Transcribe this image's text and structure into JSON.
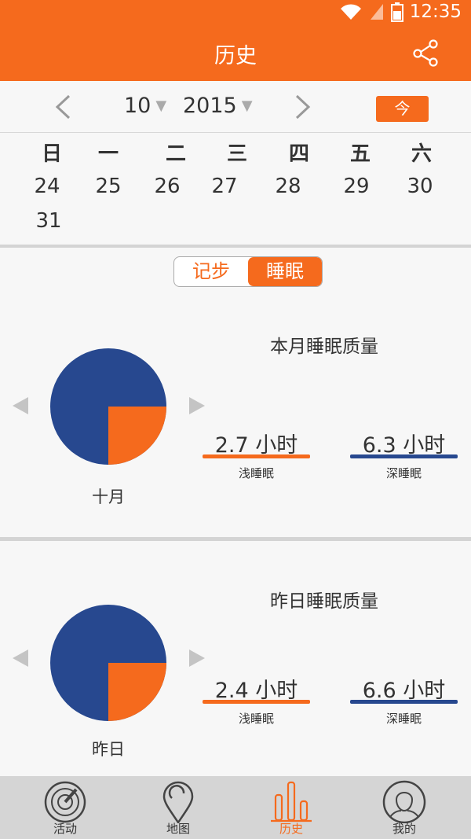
{
  "status_bar": {
    "time": "12:35"
  },
  "header": {
    "title": "历史"
  },
  "date_picker": {
    "month": "10",
    "year": "2015",
    "today_label": "今"
  },
  "calendar": {
    "weekdays": [
      "日",
      "一",
      "二",
      "三",
      "四",
      "五",
      "六"
    ],
    "week1": [
      "24",
      "25",
      "26",
      "27",
      "28",
      "29",
      "30"
    ],
    "week2": [
      "31"
    ]
  },
  "toggle": {
    "steps_label": "记步",
    "sleep_label": "睡眠",
    "selected": "sleep"
  },
  "month_section": {
    "title": "本月睡眠质量",
    "pie_label": "十月",
    "light_sleep_value": "2.7 小时",
    "light_sleep_label": "浅睡眠",
    "deep_sleep_value": "6.3 小时",
    "deep_sleep_label": "深睡眠",
    "light_fraction": 0.25
  },
  "day_section": {
    "title": "昨日睡眠质量",
    "pie_label": "昨日",
    "light_sleep_value": "2.4 小时",
    "light_sleep_label": "浅睡眠",
    "deep_sleep_value": "6.6 小时",
    "deep_sleep_label": "深睡眠",
    "light_fraction": 0.25
  },
  "tabs": [
    {
      "label": "活动",
      "icon": "activity-icon"
    },
    {
      "label": "地图",
      "icon": "map-pin-icon"
    },
    {
      "label": "历史",
      "icon": "history-bars-icon",
      "active": true
    },
    {
      "label": "我的",
      "icon": "profile-icon"
    }
  ],
  "colors": {
    "accent": "#f56a1d",
    "deep": "#27488f",
    "light": "#f56a1d"
  }
}
